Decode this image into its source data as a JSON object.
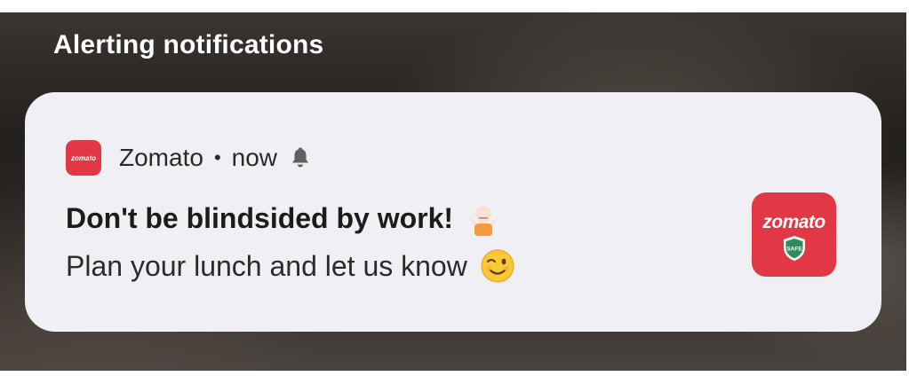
{
  "section": {
    "title": "Alerting notifications"
  },
  "notification": {
    "app_name": "Zomato",
    "separator": "•",
    "time": "now",
    "title": "Don't be blindsided by work!",
    "body": "Plan your lunch and let us know",
    "small_logo_text": "zomato",
    "large_icon": {
      "wordmark": "zomato",
      "badge": "SAFE"
    },
    "icons": {
      "app": "zomato-logo-icon",
      "alert": "bell-icon",
      "title_emoji": "person-shrugging-icon",
      "body_emoji": "winking-face-icon",
      "large": "zomato-safe-icon"
    },
    "colors": {
      "brand": "#e23744",
      "card": "#f0eff4"
    }
  }
}
